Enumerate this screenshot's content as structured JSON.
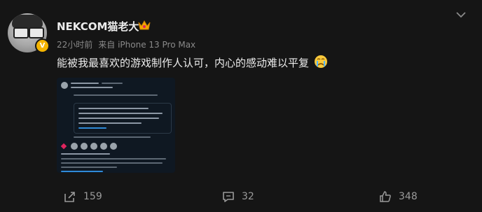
{
  "post": {
    "username": "NEKCOM猫老大",
    "verified_badge": "V",
    "time": "22小时前",
    "source": "来自 iPhone 13 Pro Max",
    "content": "能被我最喜欢的游戏制作人认可，内心的感动难以平复",
    "actions": {
      "share_count": "159",
      "comment_count": "32",
      "like_count": "348"
    }
  },
  "icons": {
    "crown": "crown-icon",
    "more": "chevron-down-icon",
    "emoji": "crying-face-emoji",
    "share": "share-icon",
    "comment": "comment-icon",
    "like": "thumbs-up-icon"
  },
  "colors": {
    "background": "#151515",
    "badge": "#f4b400",
    "crown": "#f2a600",
    "embed_background": "#0f1822",
    "link": "#2f8ad8"
  }
}
